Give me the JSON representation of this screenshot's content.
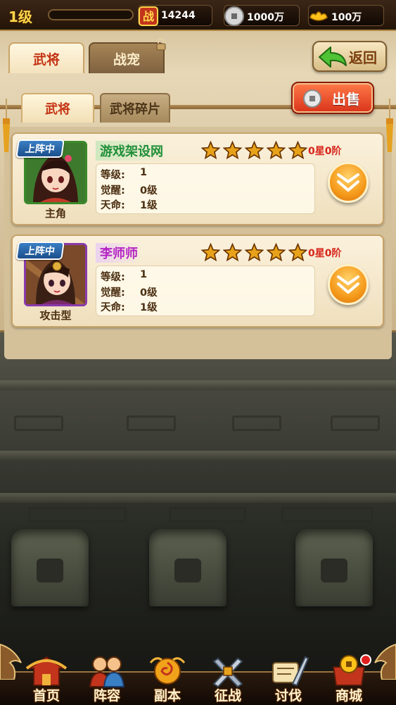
{
  "topbar": {
    "level": "1级",
    "power_icon_text": "战",
    "power": "14244",
    "silver": "1000万",
    "gold": "100万"
  },
  "tabs": {
    "main": [
      {
        "label": "武将",
        "active": true
      },
      {
        "label": "战宠",
        "active": false,
        "locked": true
      }
    ],
    "sub": [
      {
        "label": "武将",
        "active": true
      },
      {
        "label": "武将碎片",
        "active": false
      }
    ]
  },
  "buttons": {
    "back": "返回",
    "sell": "出售"
  },
  "generals": [
    {
      "badge": "上阵中",
      "name": "游戏架设网",
      "name_color": "#1f8f38",
      "name_bg": "#cfe8bf",
      "frame_color": "#3a8a2a",
      "role": "主角",
      "stars": 5,
      "rank": "0星0阶",
      "stats": [
        {
          "label": "等级:",
          "value": "1"
        },
        {
          "label": "觉醒:",
          "value": "0级"
        },
        {
          "label": "天命:",
          "value": "1级"
        }
      ]
    },
    {
      "badge": "上阵中",
      "name": "李师师",
      "name_color": "#b424c4",
      "name_bg": "#ead2ee",
      "frame_color": "#8a3aaa",
      "role": "攻击型",
      "stars": 5,
      "rank": "0星0阶",
      "stats": [
        {
          "label": "等级:",
          "value": "1"
        },
        {
          "label": "觉醒:",
          "value": "0级"
        },
        {
          "label": "天命:",
          "value": "1级"
        }
      ]
    }
  ],
  "nav": [
    {
      "label": "首页",
      "icon": "home-icon"
    },
    {
      "label": "阵容",
      "icon": "lineup-icon"
    },
    {
      "label": "副本",
      "icon": "dungeon-icon"
    },
    {
      "label": "征战",
      "icon": "battle-icon"
    },
    {
      "label": "讨伐",
      "icon": "crusade-icon"
    },
    {
      "label": "商城",
      "icon": "shop-icon",
      "notification": true
    }
  ],
  "colors": {
    "accent_red": "#c43414",
    "rank_red": "#d8241a",
    "gold": "#ffd64a"
  }
}
